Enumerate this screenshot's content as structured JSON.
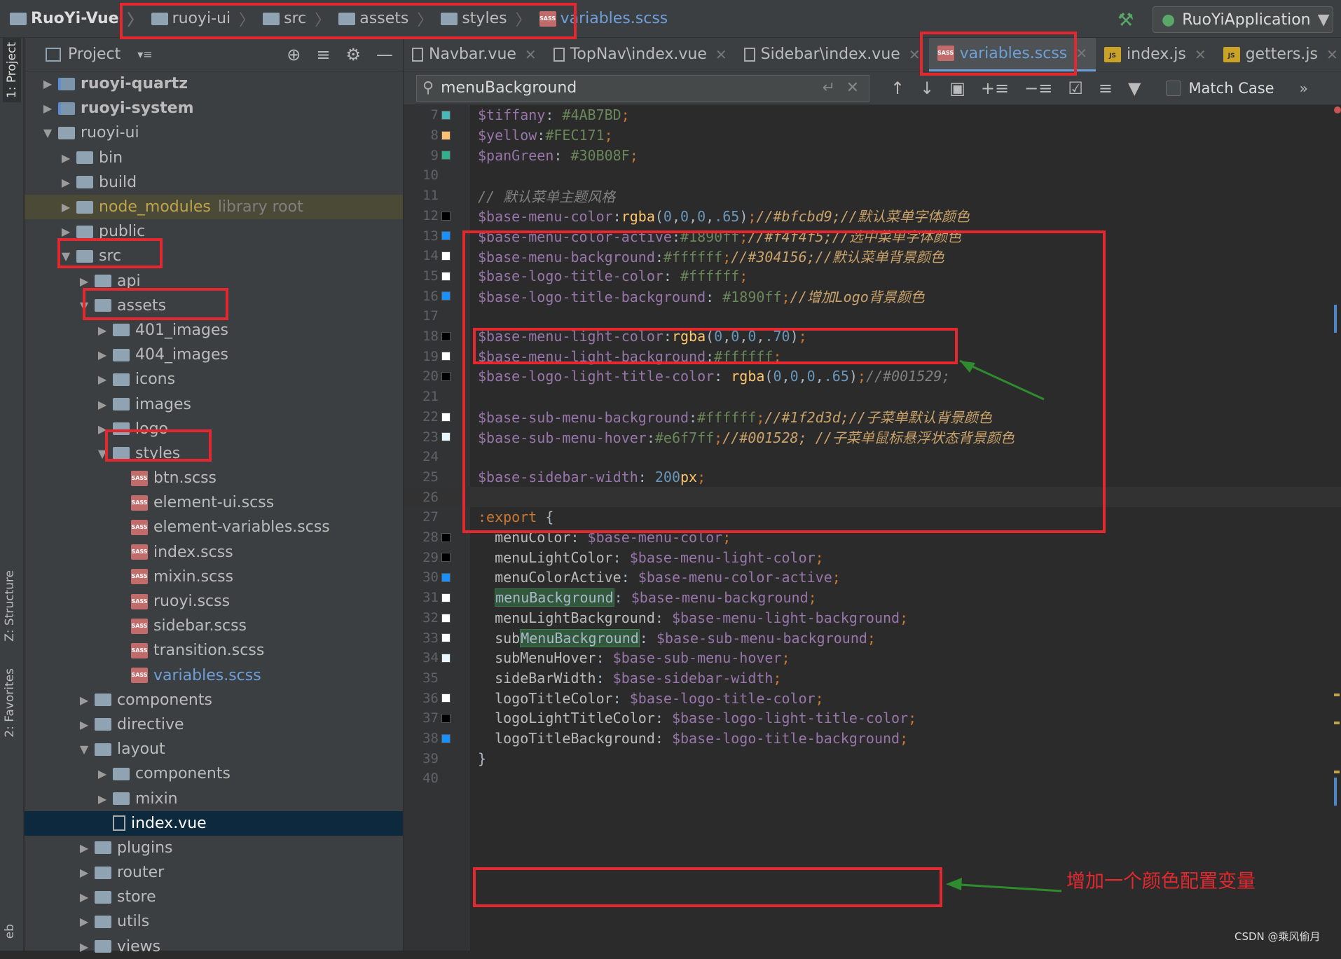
{
  "breadcrumb": {
    "project": "RuoYi-Vue",
    "items": [
      "ruoyi-ui",
      "src",
      "assets",
      "styles"
    ],
    "file": "variables.scss"
  },
  "run_config": "RuoYiApplication",
  "project_panel": {
    "title": "Project",
    "side_tabs": [
      "1: Project",
      "Z: Structure",
      "2: Favorites",
      "eb"
    ],
    "tree": [
      {
        "label": "ruoyi-quartz",
        "depth": 1,
        "kind": "module",
        "expanded": false,
        "bold": true
      },
      {
        "label": "ruoyi-system",
        "depth": 1,
        "kind": "module",
        "expanded": false,
        "bold": true
      },
      {
        "label": "ruoyi-ui",
        "depth": 1,
        "kind": "folder",
        "expanded": true
      },
      {
        "label": "bin",
        "depth": 2,
        "kind": "folder",
        "expanded": false
      },
      {
        "label": "build",
        "depth": 2,
        "kind": "folder",
        "expanded": false
      },
      {
        "label": "node_modules",
        "suffix": "library root",
        "depth": 2,
        "kind": "lib",
        "expanded": false
      },
      {
        "label": "public",
        "depth": 2,
        "kind": "folder",
        "expanded": false
      },
      {
        "label": "src",
        "depth": 2,
        "kind": "folder",
        "expanded": true
      },
      {
        "label": "api",
        "depth": 3,
        "kind": "folder",
        "expanded": false
      },
      {
        "label": "assets",
        "depth": 3,
        "kind": "folder",
        "expanded": true
      },
      {
        "label": "401_images",
        "depth": 4,
        "kind": "folder",
        "expanded": false
      },
      {
        "label": "404_images",
        "depth": 4,
        "kind": "folder",
        "expanded": false
      },
      {
        "label": "icons",
        "depth": 4,
        "kind": "folder",
        "expanded": false
      },
      {
        "label": "images",
        "depth": 4,
        "kind": "folder",
        "expanded": false
      },
      {
        "label": "logo",
        "depth": 4,
        "kind": "folder",
        "expanded": false
      },
      {
        "label": "styles",
        "depth": 4,
        "kind": "folder",
        "expanded": true
      },
      {
        "label": "btn.scss",
        "depth": 5,
        "kind": "sass"
      },
      {
        "label": "element-ui.scss",
        "depth": 5,
        "kind": "sass"
      },
      {
        "label": "element-variables.scss",
        "depth": 5,
        "kind": "sass"
      },
      {
        "label": "index.scss",
        "depth": 5,
        "kind": "sass"
      },
      {
        "label": "mixin.scss",
        "depth": 5,
        "kind": "sass"
      },
      {
        "label": "ruoyi.scss",
        "depth": 5,
        "kind": "sass"
      },
      {
        "label": "sidebar.scss",
        "depth": 5,
        "kind": "sass"
      },
      {
        "label": "transition.scss",
        "depth": 5,
        "kind": "sass"
      },
      {
        "label": "variables.scss",
        "depth": 5,
        "kind": "sass",
        "modified": true
      },
      {
        "label": "components",
        "depth": 3,
        "kind": "folder",
        "expanded": false
      },
      {
        "label": "directive",
        "depth": 3,
        "kind": "folder",
        "expanded": false
      },
      {
        "label": "layout",
        "depth": 3,
        "kind": "folder",
        "expanded": true
      },
      {
        "label": "components",
        "depth": 4,
        "kind": "folder",
        "expanded": false
      },
      {
        "label": "mixin",
        "depth": 4,
        "kind": "folder",
        "expanded": false
      },
      {
        "label": "index.vue",
        "depth": 4,
        "kind": "file",
        "selected": true
      },
      {
        "label": "plugins",
        "depth": 3,
        "kind": "folder",
        "expanded": false
      },
      {
        "label": "router",
        "depth": 3,
        "kind": "folder",
        "expanded": false
      },
      {
        "label": "store",
        "depth": 3,
        "kind": "folder",
        "expanded": false
      },
      {
        "label": "utils",
        "depth": 3,
        "kind": "folder",
        "expanded": false
      },
      {
        "label": "views",
        "depth": 3,
        "kind": "folder",
        "expanded": false
      }
    ]
  },
  "tabs": [
    {
      "label": "Navbar.vue",
      "icon": "file",
      "active": false
    },
    {
      "label": "TopNav\\index.vue",
      "icon": "file",
      "active": false
    },
    {
      "label": "Sidebar\\index.vue",
      "icon": "file",
      "active": false
    },
    {
      "label": "variables.scss",
      "icon": "sass",
      "active": true
    },
    {
      "label": "index.js",
      "icon": "js",
      "active": false
    },
    {
      "label": "getters.js",
      "icon": "js",
      "active": false
    }
  ],
  "search": {
    "value": "menuBackground",
    "match_case_label": "Match Case"
  },
  "editor_lines": [
    {
      "n": "7",
      "swatch": "#4AB7BD",
      "code": [
        [
          "v",
          "$tiffany"
        ],
        [
          "t",
          ": "
        ],
        [
          "h",
          "#4AB7BD"
        ],
        [
          "kw",
          ";"
        ]
      ]
    },
    {
      "n": "8",
      "swatch": "#FEC171",
      "code": [
        [
          "v",
          "$yellow"
        ],
        [
          "t",
          ":"
        ],
        [
          "h",
          "#FEC171"
        ],
        [
          "kw",
          ";"
        ]
      ]
    },
    {
      "n": "9",
      "swatch": "#30B08F",
      "code": [
        [
          "v",
          "$panGreen"
        ],
        [
          "t",
          ": "
        ],
        [
          "h",
          "#30B08F"
        ],
        [
          "kw",
          ";"
        ]
      ]
    },
    {
      "n": "10",
      "code": []
    },
    {
      "n": "11",
      "code": [
        [
          "c",
          "// 默认菜单主题风格"
        ]
      ]
    },
    {
      "n": "12",
      "swatch": "#000000",
      "code": [
        [
          "v",
          "$base-menu-color"
        ],
        [
          "t",
          ":"
        ],
        [
          "f",
          "rgba"
        ],
        [
          "t",
          "("
        ],
        [
          "n",
          "0"
        ],
        [
          "t",
          ","
        ],
        [
          "n",
          "0"
        ],
        [
          "t",
          ","
        ],
        [
          "n",
          "0"
        ],
        [
          "t",
          ","
        ],
        [
          "n",
          ".65"
        ],
        [
          "t",
          ")"
        ],
        [
          "kw",
          ";"
        ],
        [
          "cz",
          "//#bfcbd9;//默认菜单字体颜色"
        ]
      ]
    },
    {
      "n": "13",
      "swatch": "#1890ff",
      "code": [
        [
          "v",
          "$base-menu-color-active"
        ],
        [
          "t",
          ":"
        ],
        [
          "h",
          "#1890ff"
        ],
        [
          "kw",
          ";"
        ],
        [
          "cz",
          "//#f4f4f5;//选中菜单字体颜色"
        ]
      ]
    },
    {
      "n": "14",
      "swatch": "#ffffff",
      "code": [
        [
          "v",
          "$base-menu-background"
        ],
        [
          "t",
          ":"
        ],
        [
          "h",
          "#ffffff"
        ],
        [
          "kw",
          ";"
        ],
        [
          "cz",
          "//#304156;//默认菜单背景颜色"
        ]
      ]
    },
    {
      "n": "15",
      "swatch": "#ffffff",
      "code": [
        [
          "v",
          "$base-logo-title-color"
        ],
        [
          "t",
          ": "
        ],
        [
          "h",
          "#ffffff"
        ],
        [
          "kw",
          ";"
        ]
      ]
    },
    {
      "n": "16",
      "swatch": "#1890ff",
      "code": [
        [
          "v",
          "$base-logo-title-background"
        ],
        [
          "t",
          ": "
        ],
        [
          "h",
          "#1890ff"
        ],
        [
          "kw",
          ";"
        ],
        [
          "cz",
          "//增加Logo背景颜色"
        ]
      ]
    },
    {
      "n": "17",
      "code": []
    },
    {
      "n": "18",
      "swatch": "#000000",
      "code": [
        [
          "v",
          "$base-menu-light-color"
        ],
        [
          "t",
          ":"
        ],
        [
          "f",
          "rgba"
        ],
        [
          "t",
          "("
        ],
        [
          "n",
          "0"
        ],
        [
          "t",
          ","
        ],
        [
          "n",
          "0"
        ],
        [
          "t",
          ","
        ],
        [
          "n",
          "0"
        ],
        [
          "t",
          ","
        ],
        [
          "n",
          ".70"
        ],
        [
          "t",
          ")"
        ],
        [
          "kw",
          ";"
        ]
      ]
    },
    {
      "n": "19",
      "swatch": "#ffffff",
      "code": [
        [
          "v",
          "$base-menu-light-background"
        ],
        [
          "t",
          ":"
        ],
        [
          "h",
          "#ffffff"
        ],
        [
          "kw",
          ";"
        ]
      ]
    },
    {
      "n": "20",
      "swatch": "#000000",
      "code": [
        [
          "v",
          "$base-logo-light-title-color"
        ],
        [
          "t",
          ": "
        ],
        [
          "f",
          "rgba"
        ],
        [
          "t",
          "("
        ],
        [
          "n",
          "0"
        ],
        [
          "t",
          ","
        ],
        [
          "n",
          "0"
        ],
        [
          "t",
          ","
        ],
        [
          "n",
          "0"
        ],
        [
          "t",
          ","
        ],
        [
          "n",
          ".65"
        ],
        [
          "t",
          ")"
        ],
        [
          "kw",
          ";"
        ],
        [
          "c",
          "//#001529;"
        ]
      ]
    },
    {
      "n": "21",
      "code": []
    },
    {
      "n": "22",
      "swatch": "#ffffff",
      "code": [
        [
          "v",
          "$base-sub-menu-background"
        ],
        [
          "t",
          ":"
        ],
        [
          "h",
          "#ffffff"
        ],
        [
          "kw",
          ";"
        ],
        [
          "cz",
          "//#1f2d3d;//子菜单默认背景颜色"
        ]
      ]
    },
    {
      "n": "23",
      "swatch": "#e6f7ff",
      "code": [
        [
          "v",
          "$base-sub-menu-hover"
        ],
        [
          "t",
          ":"
        ],
        [
          "h",
          "#e6f7ff"
        ],
        [
          "kw",
          ";"
        ],
        [
          "cz",
          "//#001528; //子菜单鼠标悬浮状态背景颜色"
        ]
      ]
    },
    {
      "n": "24",
      "code": []
    },
    {
      "n": "25",
      "code": [
        [
          "v",
          "$base-sidebar-width"
        ],
        [
          "t",
          ": "
        ],
        [
          "n",
          "200"
        ],
        [
          "f",
          "px"
        ],
        [
          "kw",
          ";"
        ]
      ]
    },
    {
      "n": "26",
      "current": true,
      "code": []
    },
    {
      "n": "27",
      "code": [
        [
          "kw",
          ":export"
        ],
        [
          "t",
          " {"
        ]
      ]
    },
    {
      "n": "28",
      "swatch": "#000000",
      "code": [
        [
          "pr",
          "  menuColor"
        ],
        [
          "t",
          ": "
        ],
        [
          "v",
          "$base-menu-color"
        ],
        [
          "kw",
          ";"
        ]
      ]
    },
    {
      "n": "29",
      "swatch": "#000000",
      "code": [
        [
          "pr",
          "  menuLightColor"
        ],
        [
          "t",
          ": "
        ],
        [
          "v",
          "$base-menu-light-color"
        ],
        [
          "kw",
          ";"
        ]
      ]
    },
    {
      "n": "30",
      "swatch": "#1890ff",
      "code": [
        [
          "pr",
          "  menuColorActive"
        ],
        [
          "t",
          ": "
        ],
        [
          "v",
          "$base-menu-color-active"
        ],
        [
          "kw",
          ";"
        ]
      ]
    },
    {
      "n": "31",
      "swatch": "#ffffff",
      "code": [
        [
          "t",
          "  "
        ],
        [
          "hl",
          "menuBackground"
        ],
        [
          "t",
          ": "
        ],
        [
          "v",
          "$base-menu-background"
        ],
        [
          "kw",
          ";"
        ]
      ]
    },
    {
      "n": "32",
      "swatch": "#ffffff",
      "code": [
        [
          "pr",
          "  menuLightBackground"
        ],
        [
          "t",
          ": "
        ],
        [
          "v",
          "$base-menu-light-background"
        ],
        [
          "kw",
          ";"
        ]
      ]
    },
    {
      "n": "33",
      "swatch": "#ffffff",
      "code": [
        [
          "pr",
          "  sub"
        ],
        [
          "hl",
          "MenuBackground"
        ],
        [
          "t",
          ": "
        ],
        [
          "v",
          "$base-sub-menu-background"
        ],
        [
          "kw",
          ";"
        ]
      ]
    },
    {
      "n": "34",
      "swatch": "#e6f7ff",
      "code": [
        [
          "pr",
          "  subMenuHover"
        ],
        [
          "t",
          ": "
        ],
        [
          "v",
          "$base-sub-menu-hover"
        ],
        [
          "kw",
          ";"
        ]
      ]
    },
    {
      "n": "35",
      "code": [
        [
          "pr",
          "  sideBarWidth"
        ],
        [
          "t",
          ": "
        ],
        [
          "v",
          "$base-sidebar-width"
        ],
        [
          "kw",
          ";"
        ]
      ]
    },
    {
      "n": "36",
      "swatch": "#ffffff",
      "code": [
        [
          "pr",
          "  logoTitleColor"
        ],
        [
          "t",
          ": "
        ],
        [
          "v",
          "$base-logo-title-color"
        ],
        [
          "kw",
          ";"
        ]
      ]
    },
    {
      "n": "37",
      "swatch": "#000000",
      "code": [
        [
          "pr",
          "  logoLightTitleColor"
        ],
        [
          "t",
          ": "
        ],
        [
          "v",
          "$base-logo-light-title-color"
        ],
        [
          "kw",
          ";"
        ]
      ]
    },
    {
      "n": "38",
      "swatch": "#1890ff",
      "code": [
        [
          "pr",
          "  logoTitleBackground"
        ],
        [
          "t",
          ": "
        ],
        [
          "v",
          "$base-logo-title-background"
        ],
        [
          "kw",
          ";"
        ]
      ]
    },
    {
      "n": "39",
      "code": [
        [
          "t",
          "}"
        ]
      ]
    },
    {
      "n": "40",
      "code": []
    }
  ],
  "annotation_text": "增加一个颜色配置变量",
  "watermark": "CSDN @乘风偷月"
}
